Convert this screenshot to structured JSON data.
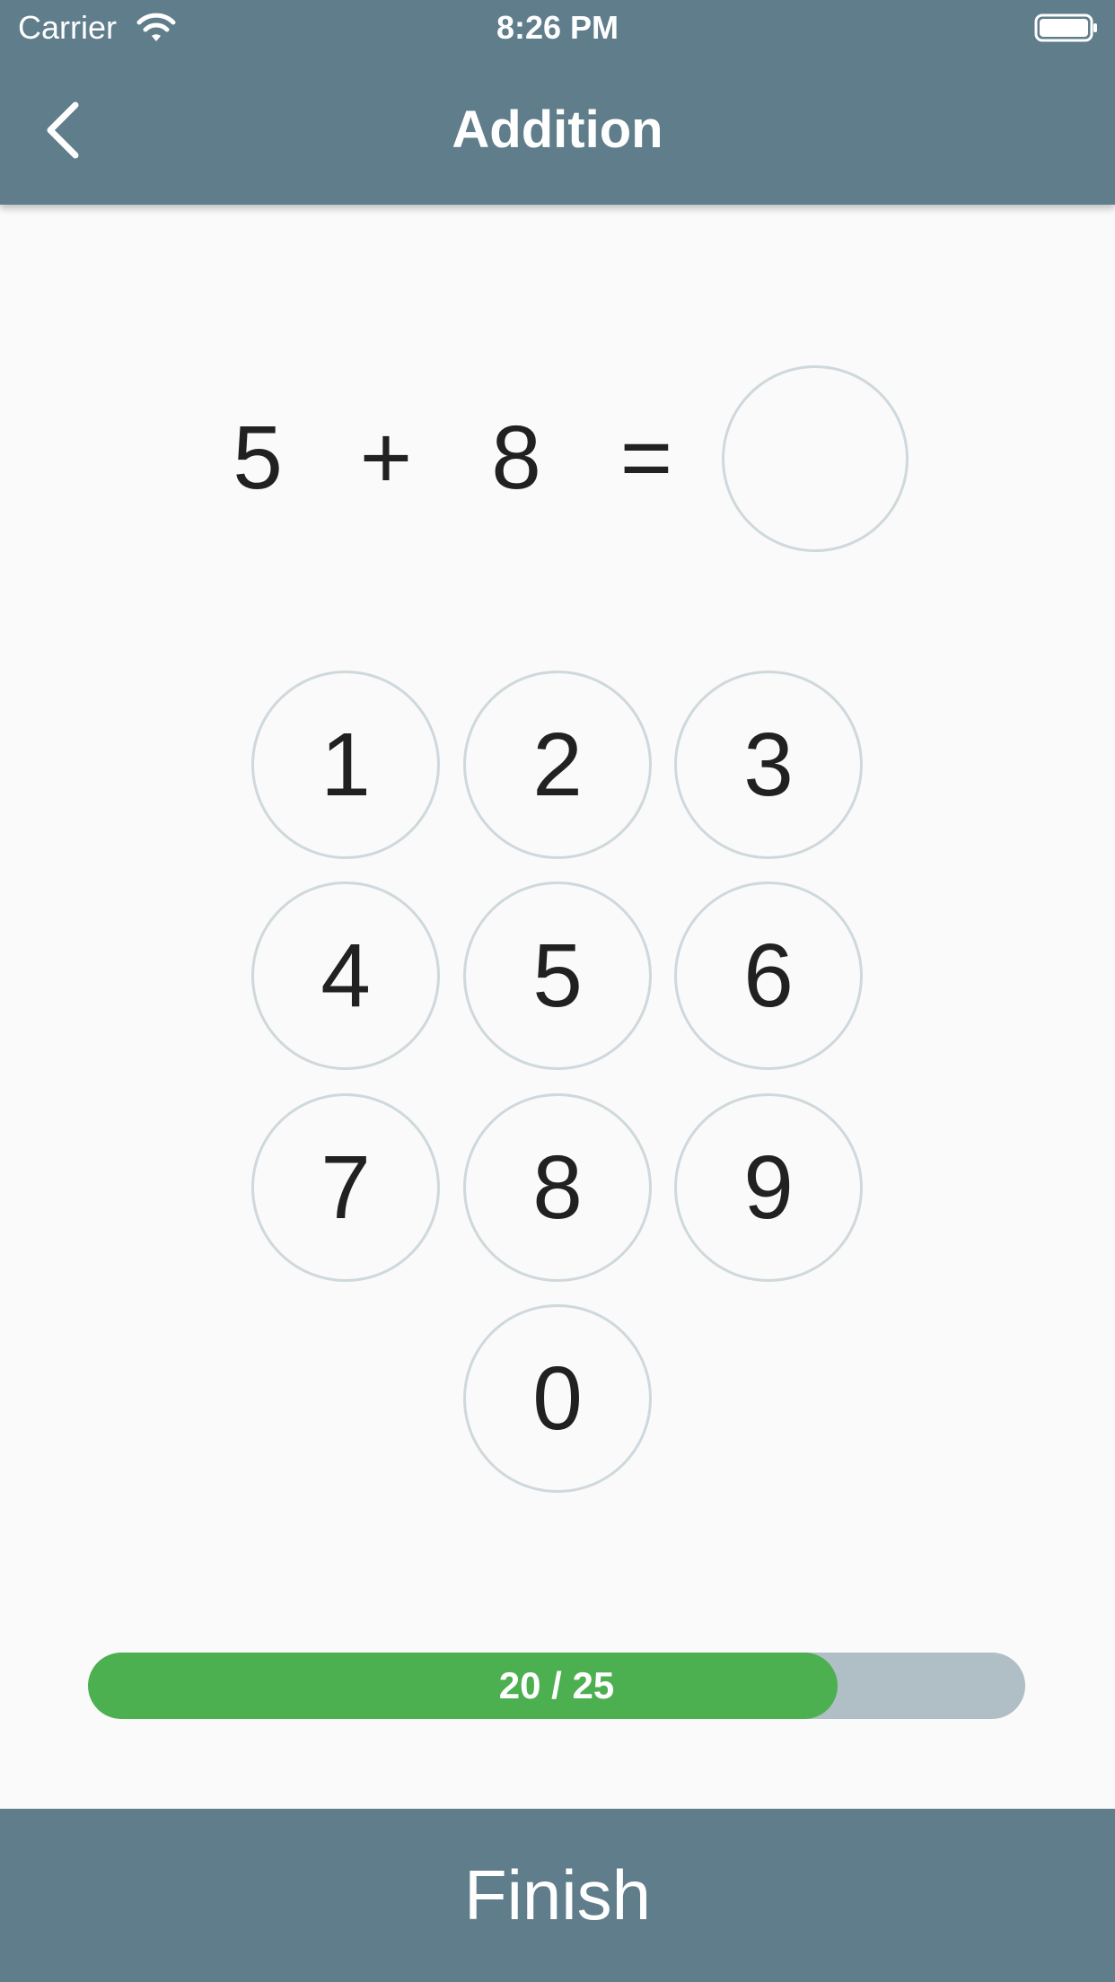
{
  "status_bar": {
    "carrier": "Carrier",
    "time": "8:26 PM",
    "wifi_icon": "wifi-icon",
    "battery_icon": "battery-icon"
  },
  "header": {
    "title": "Addition",
    "back_icon": "chevron-left-icon"
  },
  "equation": {
    "operand_a": "5",
    "operator": "+",
    "operand_b": "8",
    "equals": "=",
    "answer": ""
  },
  "keypad": {
    "keys": [
      "1",
      "2",
      "3",
      "4",
      "5",
      "6",
      "7",
      "8",
      "9",
      "0"
    ]
  },
  "progress": {
    "label": "20 / 25",
    "current": 20,
    "total": 25
  },
  "footer": {
    "finish_label": "Finish"
  },
  "colors": {
    "primary": "#607d8b",
    "progress_fill": "#4caf50",
    "progress_track": "#b0bec5",
    "circle_border": "#cfd8dc",
    "background": "#fafafa"
  }
}
